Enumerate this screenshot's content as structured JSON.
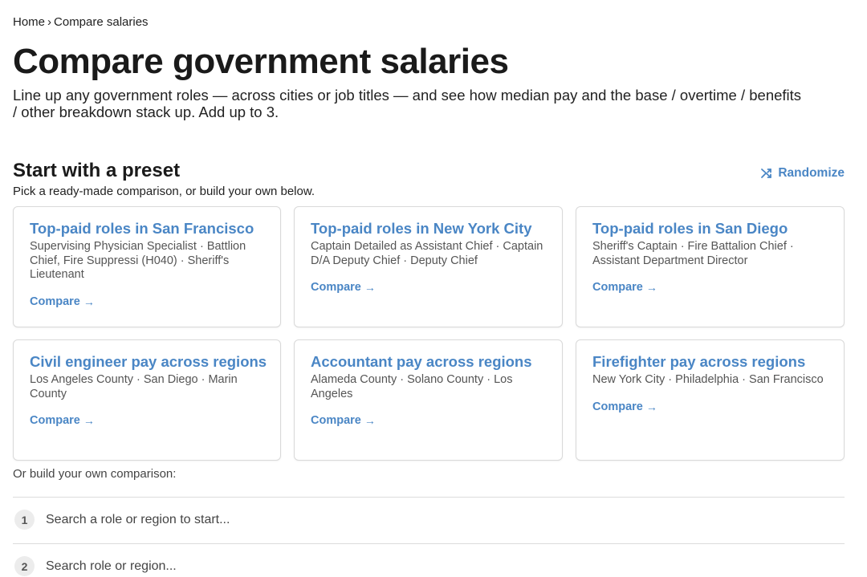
{
  "breadcrumb": {
    "home": "Home",
    "separator": "›",
    "current": "Compare salaries"
  },
  "page": {
    "title": "Compare government salaries",
    "intro": "Line up any government roles — across cities or job titles — and see how median pay and the base / overtime / benefits / other breakdown stack up. Add up to 3."
  },
  "presets": {
    "heading": "Start with a preset",
    "subheading": "Pick a ready-made comparison, or build your own below.",
    "randomize_label": "Randomize",
    "compare_label": "Compare",
    "arrow": "→",
    "cards": [
      {
        "title": "Top-paid roles in San Francisco",
        "desc": "Supervising Physician Specialist · Battlion Chief, Fire Suppressi (H040) · Sheriff's Lieutenant"
      },
      {
        "title": "Top-paid roles in New York City",
        "desc": "Captain Detailed as Assistant Chief · Captain D/A Deputy Chief · Deputy Chief"
      },
      {
        "title": "Top-paid roles in San Diego",
        "desc": "Sheriff's Captain · Fire Battalion Chief · Assistant Department Director"
      },
      {
        "title": "Civil engineer pay across regions",
        "desc": "Los Angeles County · San Diego · Marin County"
      },
      {
        "title": "Accountant pay across regions",
        "desc": "Alameda County · Solano County · Los Angeles"
      },
      {
        "title": "Firefighter pay across regions",
        "desc": "New York City · Philadelphia · San Francisco"
      }
    ]
  },
  "builder": {
    "label": "Or build your own comparison:",
    "slots": [
      {
        "number": "1",
        "placeholder": "Search a role or region to start..."
      },
      {
        "number": "2",
        "placeholder": "Search role or region..."
      }
    ]
  },
  "colors": {
    "accent": "#4a86c5",
    "text": "#1f1f1f",
    "border": "#d9d9d9"
  },
  "icons": {
    "randomize": "shuffle-icon",
    "compare": "arrow-right-icon"
  }
}
